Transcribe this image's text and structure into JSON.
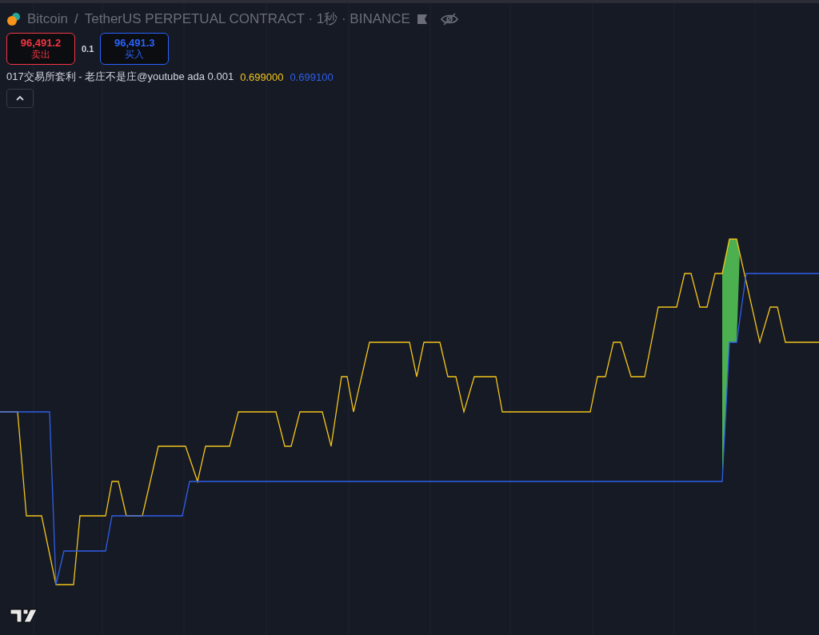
{
  "symbol": {
    "name": "Bitcoin",
    "separator": "/",
    "details": "TetherUS PERPETUAL CONTRACT · 1秒 · BINANCE"
  },
  "trade": {
    "sell": {
      "price": "96,491.2",
      "label": "卖出"
    },
    "spread": "0.1",
    "buy": {
      "price": "96,491.3",
      "label": "买入"
    }
  },
  "indicator": {
    "title": "017交易所套利 - 老庄不是庄@youtube ada 0.001",
    "values": [
      {
        "text": "0.699000",
        "color": "#f2c41b"
      },
      {
        "text": "0.699100",
        "color": "#2f5fe8"
      }
    ]
  }
}
